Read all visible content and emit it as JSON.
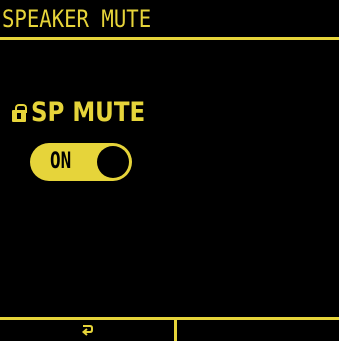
{
  "screen": {
    "title": "SPEAKER MUTE"
  },
  "setting": {
    "label": "SP MUTE",
    "lock_icon": "lock-icon",
    "toggle": {
      "state_label": "ON",
      "value": true
    }
  },
  "soft_keys": {
    "left": {
      "icon": "return-icon"
    },
    "right": {
      "label": ""
    }
  },
  "colors": {
    "accent": "#e6d43a",
    "background": "#000000"
  }
}
